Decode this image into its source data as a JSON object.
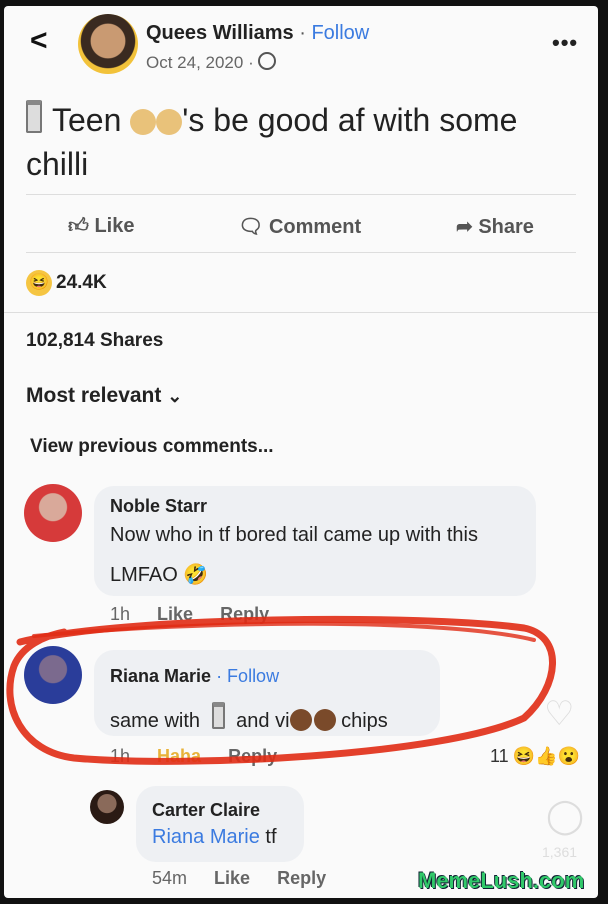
{
  "header": {
    "back": "<",
    "author": "Quees Williams",
    "separator": "·",
    "follow": "Follow",
    "date": "Oct 24, 2020 ·",
    "more": "•••"
  },
  "post": {
    "text_part1": "Teen",
    "text_part2": "'s  be good af with some chilli"
  },
  "actions": {
    "like": "Like",
    "comment": "Comment",
    "share": "Share"
  },
  "reactions": {
    "count": "24.4K",
    "shares": "102,814 Shares"
  },
  "sort": {
    "label": "Most relevant",
    "chevron": "⌄"
  },
  "view_previous": "View previous comments...",
  "comments": [
    {
      "name": "Noble Starr",
      "line1": "Now who in tf bored tail came up with this",
      "line2": "LMFAO",
      "time": "1h",
      "like": "Like",
      "reply": "Reply"
    },
    {
      "name": "Riana Marie",
      "follow": "· Follow",
      "text_a": "same with",
      "text_b": "and vi",
      "text_c": "chips",
      "time": "1h",
      "haha": "Haha",
      "reply": "Reply",
      "react_count": "11"
    },
    {
      "name": "Carter Claire",
      "mention": "Riana Marie",
      "text": "tf",
      "time": "54m",
      "like": "Like",
      "reply": "Reply"
    }
  ],
  "side": {
    "count": "1,361"
  },
  "watermark": "MemeLush.com",
  "colors": {
    "accent": "#3b7be0",
    "haha": "#e8b23a",
    "scribble": "#e02b14"
  }
}
